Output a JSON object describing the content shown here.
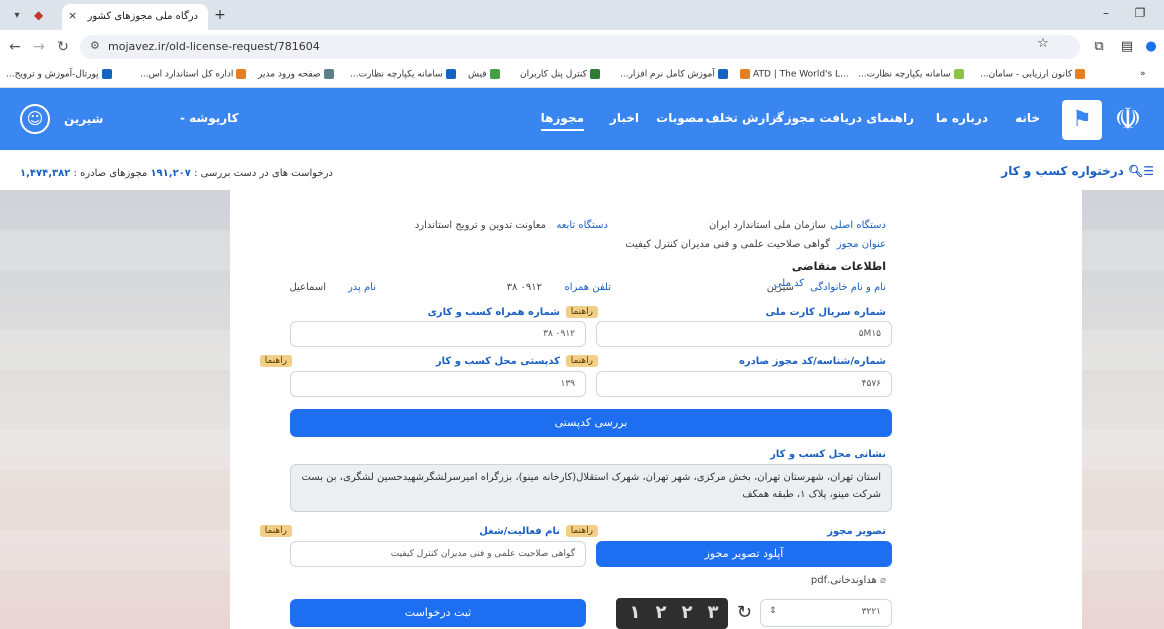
{
  "browser": {
    "tab_title": "درگاه ملی مجوزهای کشور",
    "tab_close": "×",
    "new_tab": "+",
    "url": "mojavez.ir/old-license-request/781604",
    "minimize": "–",
    "restore": "❐"
  },
  "bookmarks": [
    {
      "label": "کانون ارزیابی - سامان...",
      "color": "#e67e22"
    },
    {
      "label": "سامانه یکپارچه نظارت...",
      "color": "#8bc34a"
    },
    {
      "label": "ATD | The World's L...",
      "color": "#e67e22"
    },
    {
      "label": "آموزش کامل نرم افزار...",
      "color": "#1565c0"
    },
    {
      "label": "کنترل پنل کاربران",
      "color": "#2e7d32"
    },
    {
      "label": "فیش",
      "color": "#43a047"
    },
    {
      "label": "سامانه یکپارچه نظارت...",
      "color": "#1565c0"
    },
    {
      "label": "صفحه ورود مدیر",
      "color": "#607d8b"
    },
    {
      "label": "اداره کل استاندارد اس...",
      "color": "#e67e22"
    },
    {
      "label": "پورتال-آموزش و ترویج...",
      "color": "#1565c0"
    }
  ],
  "bookmarks_more": "»",
  "site_nav": {
    "links": [
      "خانه",
      "درباره ما",
      "راهنمای دریافت مجوز -",
      "گزارش تخلف",
      "مصوبات",
      "اخبار",
      "مجوزها"
    ],
    "user_menu": "کارپوشه -",
    "user_name": "شیرین"
  },
  "subbar": {
    "title": "درختواره کسب و کار",
    "stats_label": "درخواست های در دست بررسی :",
    "stats_pending": "۱۹۱,۲۰۷",
    "stats_issued_label": "مجوزهای صادره :",
    "stats_issued": "۱,۴۷۴,۳۸۲"
  },
  "form": {
    "device_main_label": "دستگاه اصلی",
    "device_main_value": "سازمان ملی استاندارد ایران",
    "device_sub_label": "دستگاه تابعه",
    "device_sub_value": "معاونت تدوین و ترویج استاندارد",
    "license_title_label": "عنوان مجوز",
    "license_title_value": "گواهی صلاحیت علمی و فنی مدیران کنترل کیفیت",
    "applicant_heading": "اطلاعات متقاضی",
    "name_label": "نام و نام خانوادگی",
    "name_value": "شیرین",
    "national_code_label": "کد ملی",
    "mobile_label": "تلفن همراه",
    "mobile_value": "۰۹۱۲    ۳۸",
    "father_label": "نام پدر",
    "father_value": "اسماعیل",
    "card_serial_label": "شماره سریال کارت ملی",
    "card_serial_value": "۵M۱۵",
    "business_mobile_label": "شماره همراه کسب و کاری",
    "business_mobile_value": "۰۹۱۲    ۳۸",
    "license_id_label": "شماره/شناسه/کد مجوز صادره",
    "license_id_value": "۴۵۷۶",
    "postal_code_label": "کدپستی محل کسب و کار",
    "postal_code_value": "۱۳۹",
    "help": "راهنما",
    "check_postal_button": "بررسی کدپستی",
    "address_label": "نشانی محل کسب و کار",
    "address_value": "استان تهران، شهرستان تهران، بخش مرکزی، شهر تهران، شهرک استقلال(کارخانه مینو)، بزرگراه امیرسرلشگرشهیدحسین لشگری، بن بست شرکت مینو، پلاک ۱، طبقه همکف",
    "license_image_label": "تصویر مجوز",
    "upload_button": "آپلود تصویر مجوز",
    "activity_label": "نام فعالیت/شغل",
    "activity_value": "گواهی صلاحیت علمی و فنی مدیران کنترل کیفیت",
    "file_name": "هداوندخانی.pdf",
    "captcha_digits": [
      "۳",
      "۲",
      "۲",
      "۱"
    ],
    "captcha_input_value": "۳۲۲۱",
    "submit_button": "ثبت درخواست"
  }
}
